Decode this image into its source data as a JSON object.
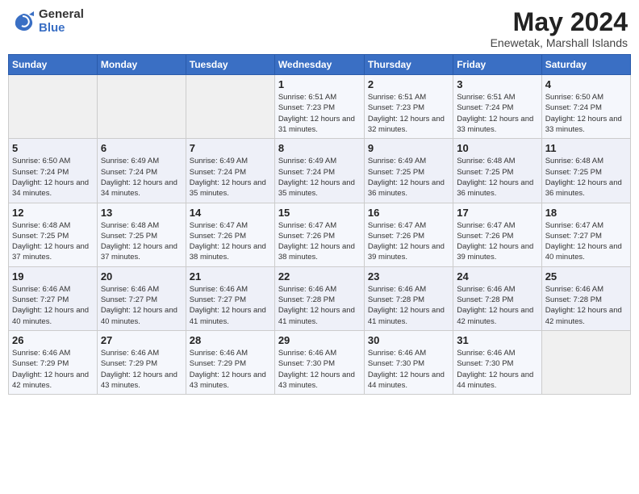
{
  "header": {
    "logo_general": "General",
    "logo_blue": "Blue",
    "month": "May 2024",
    "location": "Enewetak, Marshall Islands"
  },
  "days_of_week": [
    "Sunday",
    "Monday",
    "Tuesday",
    "Wednesday",
    "Thursday",
    "Friday",
    "Saturday"
  ],
  "weeks": [
    [
      {
        "day": "",
        "sunrise": "",
        "sunset": "",
        "daylight": ""
      },
      {
        "day": "",
        "sunrise": "",
        "sunset": "",
        "daylight": ""
      },
      {
        "day": "",
        "sunrise": "",
        "sunset": "",
        "daylight": ""
      },
      {
        "day": "1",
        "sunrise": "Sunrise: 6:51 AM",
        "sunset": "Sunset: 7:23 PM",
        "daylight": "Daylight: 12 hours and 31 minutes."
      },
      {
        "day": "2",
        "sunrise": "Sunrise: 6:51 AM",
        "sunset": "Sunset: 7:23 PM",
        "daylight": "Daylight: 12 hours and 32 minutes."
      },
      {
        "day": "3",
        "sunrise": "Sunrise: 6:51 AM",
        "sunset": "Sunset: 7:24 PM",
        "daylight": "Daylight: 12 hours and 33 minutes."
      },
      {
        "day": "4",
        "sunrise": "Sunrise: 6:50 AM",
        "sunset": "Sunset: 7:24 PM",
        "daylight": "Daylight: 12 hours and 33 minutes."
      }
    ],
    [
      {
        "day": "5",
        "sunrise": "Sunrise: 6:50 AM",
        "sunset": "Sunset: 7:24 PM",
        "daylight": "Daylight: 12 hours and 34 minutes."
      },
      {
        "day": "6",
        "sunrise": "Sunrise: 6:49 AM",
        "sunset": "Sunset: 7:24 PM",
        "daylight": "Daylight: 12 hours and 34 minutes."
      },
      {
        "day": "7",
        "sunrise": "Sunrise: 6:49 AM",
        "sunset": "Sunset: 7:24 PM",
        "daylight": "Daylight: 12 hours and 35 minutes."
      },
      {
        "day": "8",
        "sunrise": "Sunrise: 6:49 AM",
        "sunset": "Sunset: 7:24 PM",
        "daylight": "Daylight: 12 hours and 35 minutes."
      },
      {
        "day": "9",
        "sunrise": "Sunrise: 6:49 AM",
        "sunset": "Sunset: 7:25 PM",
        "daylight": "Daylight: 12 hours and 36 minutes."
      },
      {
        "day": "10",
        "sunrise": "Sunrise: 6:48 AM",
        "sunset": "Sunset: 7:25 PM",
        "daylight": "Daylight: 12 hours and 36 minutes."
      },
      {
        "day": "11",
        "sunrise": "Sunrise: 6:48 AM",
        "sunset": "Sunset: 7:25 PM",
        "daylight": "Daylight: 12 hours and 36 minutes."
      }
    ],
    [
      {
        "day": "12",
        "sunrise": "Sunrise: 6:48 AM",
        "sunset": "Sunset: 7:25 PM",
        "daylight": "Daylight: 12 hours and 37 minutes."
      },
      {
        "day": "13",
        "sunrise": "Sunrise: 6:48 AM",
        "sunset": "Sunset: 7:25 PM",
        "daylight": "Daylight: 12 hours and 37 minutes."
      },
      {
        "day": "14",
        "sunrise": "Sunrise: 6:47 AM",
        "sunset": "Sunset: 7:26 PM",
        "daylight": "Daylight: 12 hours and 38 minutes."
      },
      {
        "day": "15",
        "sunrise": "Sunrise: 6:47 AM",
        "sunset": "Sunset: 7:26 PM",
        "daylight": "Daylight: 12 hours and 38 minutes."
      },
      {
        "day": "16",
        "sunrise": "Sunrise: 6:47 AM",
        "sunset": "Sunset: 7:26 PM",
        "daylight": "Daylight: 12 hours and 39 minutes."
      },
      {
        "day": "17",
        "sunrise": "Sunrise: 6:47 AM",
        "sunset": "Sunset: 7:26 PM",
        "daylight": "Daylight: 12 hours and 39 minutes."
      },
      {
        "day": "18",
        "sunrise": "Sunrise: 6:47 AM",
        "sunset": "Sunset: 7:27 PM",
        "daylight": "Daylight: 12 hours and 40 minutes."
      }
    ],
    [
      {
        "day": "19",
        "sunrise": "Sunrise: 6:46 AM",
        "sunset": "Sunset: 7:27 PM",
        "daylight": "Daylight: 12 hours and 40 minutes."
      },
      {
        "day": "20",
        "sunrise": "Sunrise: 6:46 AM",
        "sunset": "Sunset: 7:27 PM",
        "daylight": "Daylight: 12 hours and 40 minutes."
      },
      {
        "day": "21",
        "sunrise": "Sunrise: 6:46 AM",
        "sunset": "Sunset: 7:27 PM",
        "daylight": "Daylight: 12 hours and 41 minutes."
      },
      {
        "day": "22",
        "sunrise": "Sunrise: 6:46 AM",
        "sunset": "Sunset: 7:28 PM",
        "daylight": "Daylight: 12 hours and 41 minutes."
      },
      {
        "day": "23",
        "sunrise": "Sunrise: 6:46 AM",
        "sunset": "Sunset: 7:28 PM",
        "daylight": "Daylight: 12 hours and 41 minutes."
      },
      {
        "day": "24",
        "sunrise": "Sunrise: 6:46 AM",
        "sunset": "Sunset: 7:28 PM",
        "daylight": "Daylight: 12 hours and 42 minutes."
      },
      {
        "day": "25",
        "sunrise": "Sunrise: 6:46 AM",
        "sunset": "Sunset: 7:28 PM",
        "daylight": "Daylight: 12 hours and 42 minutes."
      }
    ],
    [
      {
        "day": "26",
        "sunrise": "Sunrise: 6:46 AM",
        "sunset": "Sunset: 7:29 PM",
        "daylight": "Daylight: 12 hours and 42 minutes."
      },
      {
        "day": "27",
        "sunrise": "Sunrise: 6:46 AM",
        "sunset": "Sunset: 7:29 PM",
        "daylight": "Daylight: 12 hours and 43 minutes."
      },
      {
        "day": "28",
        "sunrise": "Sunrise: 6:46 AM",
        "sunset": "Sunset: 7:29 PM",
        "daylight": "Daylight: 12 hours and 43 minutes."
      },
      {
        "day": "29",
        "sunrise": "Sunrise: 6:46 AM",
        "sunset": "Sunset: 7:30 PM",
        "daylight": "Daylight: 12 hours and 43 minutes."
      },
      {
        "day": "30",
        "sunrise": "Sunrise: 6:46 AM",
        "sunset": "Sunset: 7:30 PM",
        "daylight": "Daylight: 12 hours and 44 minutes."
      },
      {
        "day": "31",
        "sunrise": "Sunrise: 6:46 AM",
        "sunset": "Sunset: 7:30 PM",
        "daylight": "Daylight: 12 hours and 44 minutes."
      },
      {
        "day": "",
        "sunrise": "",
        "sunset": "",
        "daylight": ""
      }
    ]
  ]
}
